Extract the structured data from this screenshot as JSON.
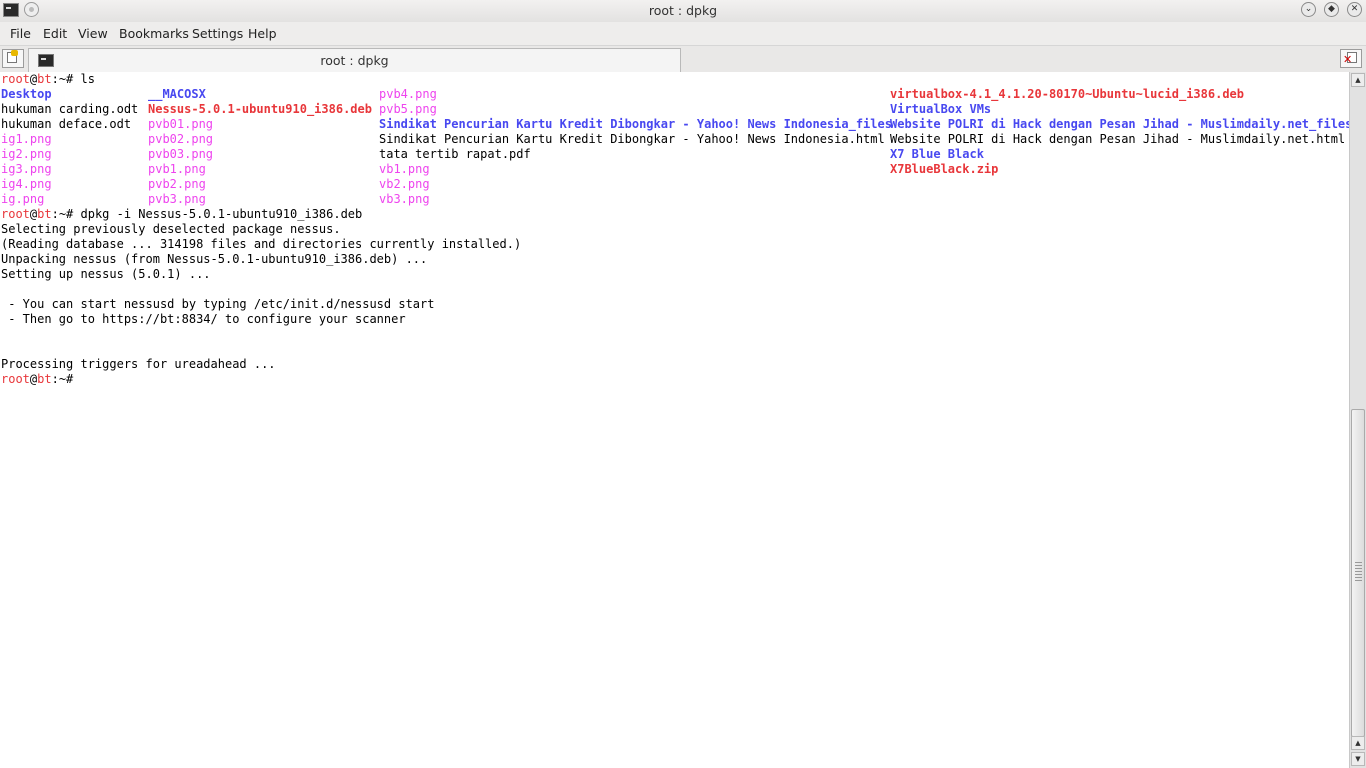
{
  "window": {
    "title": "root : dpkg",
    "buttons": [
      "minimize",
      "restore",
      "close"
    ]
  },
  "menubar": {
    "items": [
      "File",
      "Edit",
      "View",
      "Bookmarks",
      "Settings",
      "Help"
    ]
  },
  "tabs": [
    {
      "label": "root : dpkg",
      "active": true
    }
  ],
  "terminal": {
    "prompt": {
      "user": "root",
      "host": "bt",
      "path": ":~# "
    },
    "commands": [
      "ls",
      "dpkg -i Nessus-5.0.1-ubuntu910_i386.deb"
    ],
    "ls_grid": [
      [
        {
          "text": "Desktop",
          "color": "blue"
        },
        {
          "text": "__MACOSX",
          "color": "blue"
        },
        {
          "text": "pvb4.png",
          "color": "magenta"
        },
        {
          "text": "virtualbox-4.1_4.1.20-80170~Ubuntu~lucid_i386.deb",
          "color": "redb"
        }
      ],
      [
        {
          "text": "hukuman carding.odt",
          "color": "plain"
        },
        {
          "text": "Nessus-5.0.1-ubuntu910_i386.deb",
          "color": "redb"
        },
        {
          "text": "pvb5.png",
          "color": "magenta"
        },
        {
          "text": "VirtualBox VMs",
          "color": "blue"
        }
      ],
      [
        {
          "text": "hukuman deface.odt",
          "color": "plain"
        },
        {
          "text": "pvb01.png",
          "color": "magenta"
        },
        {
          "text": "Sindikat Pencurian Kartu Kredit Dibongkar - Yahoo! News Indonesia_files",
          "color": "blue"
        },
        {
          "text": "Website POLRI di Hack dengan Pesan Jihad - Muslimdaily.net_files",
          "color": "blue"
        }
      ],
      [
        {
          "text": "ig1.png",
          "color": "magenta"
        },
        {
          "text": "pvb02.png",
          "color": "magenta"
        },
        {
          "text": "Sindikat Pencurian Kartu Kredit Dibongkar - Yahoo! News Indonesia.html",
          "color": "plain"
        },
        {
          "text": "Website POLRI di Hack dengan Pesan Jihad - Muslimdaily.net.html",
          "color": "plain"
        }
      ],
      [
        {
          "text": "ig2.png",
          "color": "magenta"
        },
        {
          "text": "pvb03.png",
          "color": "magenta"
        },
        {
          "text": "tata tertib rapat.pdf",
          "color": "plain"
        },
        {
          "text": "X7 Blue Black",
          "color": "blue"
        }
      ],
      [
        {
          "text": "ig3.png",
          "color": "magenta"
        },
        {
          "text": "pvb1.png",
          "color": "magenta"
        },
        {
          "text": "vb1.png",
          "color": "magenta"
        },
        {
          "text": "X7BlueBlack.zip",
          "color": "redb"
        }
      ],
      [
        {
          "text": "ig4.png",
          "color": "magenta"
        },
        {
          "text": "pvb2.png",
          "color": "magenta"
        },
        {
          "text": "vb2.png",
          "color": "magenta"
        },
        {
          "text": "",
          "color": "plain"
        }
      ],
      [
        {
          "text": "ig.png",
          "color": "magenta"
        },
        {
          "text": "pvb3.png",
          "color": "magenta"
        },
        {
          "text": "vb3.png",
          "color": "magenta"
        },
        {
          "text": "",
          "color": "plain"
        }
      ]
    ],
    "output_lines": [
      "Selecting previously deselected package nessus.",
      "(Reading database ... 314198 files and directories currently installed.)",
      "Unpacking nessus (from Nessus-5.0.1-ubuntu910_i386.deb) ...",
      "Setting up nessus (5.0.1) ...",
      "",
      " - You can start nessusd by typing /etc/init.d/nessusd start",
      " - Then go to https://bt:8834/ to configure your scanner",
      "",
      "",
      "Processing triggers for ureadahead ..."
    ]
  },
  "colors": {
    "prompt_red": "#e8363a",
    "dir_blue": "#4848f0",
    "image_magenta": "#ee44ee",
    "archive_red": "#e8363a"
  }
}
